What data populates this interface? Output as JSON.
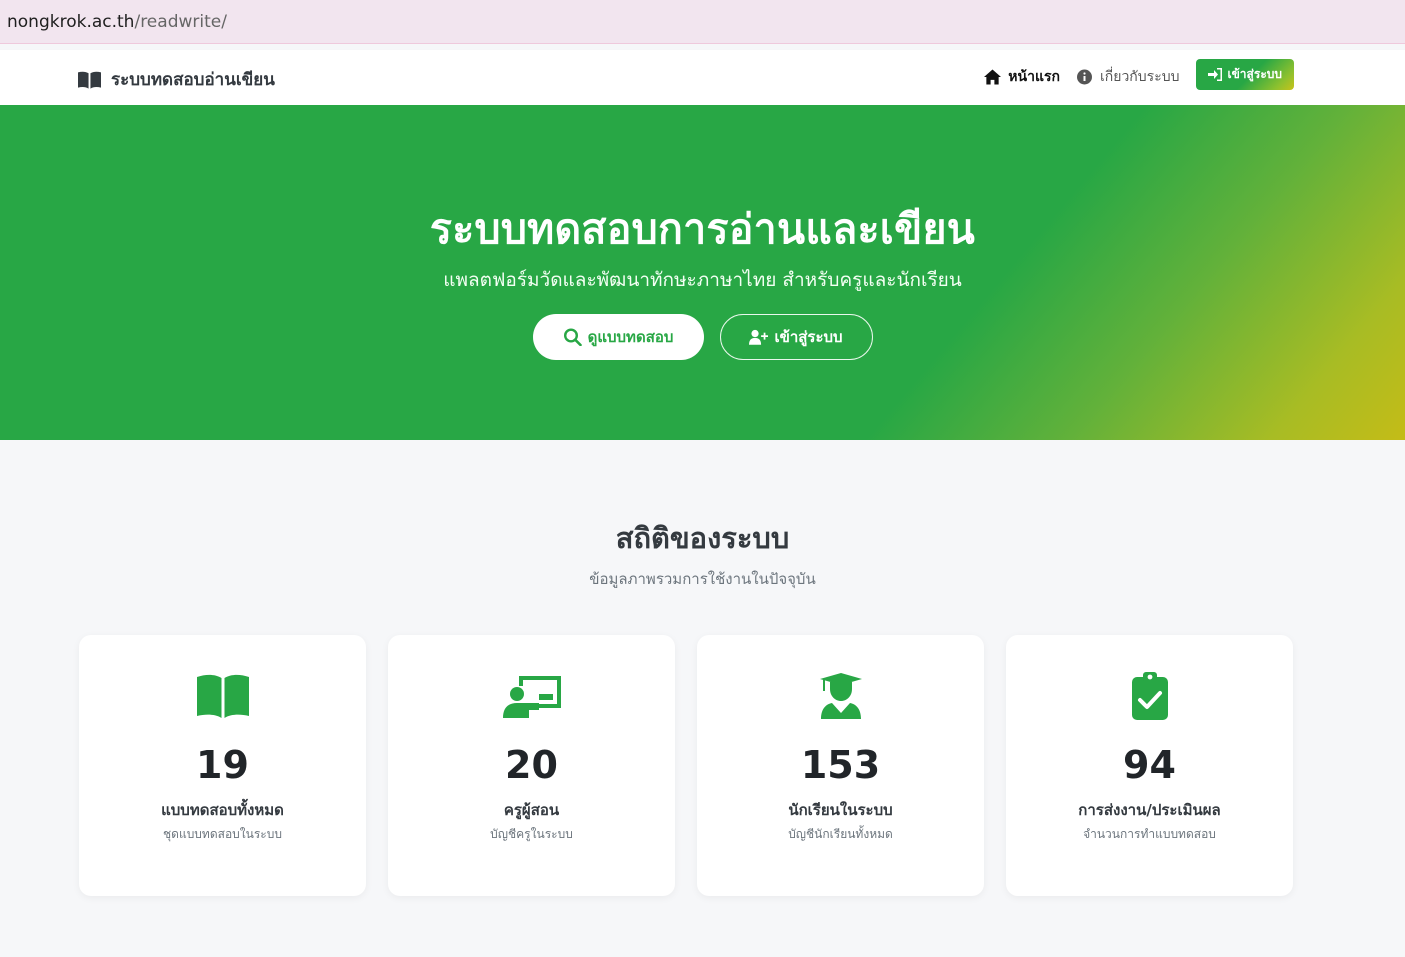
{
  "browser": {
    "url_host": "nongkrok.ac.th",
    "url_path": "/readwrite/"
  },
  "navbar": {
    "brand": "ระบบทดสอบอ่านเขียน",
    "brand_icon": "book-open-icon",
    "links": {
      "home": "หน้าแรก",
      "about": "เกี่ยวกับระบบ"
    },
    "login": "เข้าสู่ระบบ"
  },
  "hero": {
    "title": "ระบบทดสอบการอ่านและเขียน",
    "subtitle": "แพลตฟอร์มวัดและพัฒนาทักษะภาษาไทย สำหรับครูและนักเรียน",
    "btn_view": "ดูแบบทดสอบ",
    "btn_login": "เข้าสู่ระบบ"
  },
  "stats": {
    "title": "สถิติของระบบ",
    "subtitle": "ข้อมูลภาพรวมการใช้งานในปัจจุบัน",
    "cards": [
      {
        "icon": "book-open-icon",
        "value": "19",
        "label": "แบบทดสอบทั้งหมด",
        "desc": "ชุดแบบทดสอบในระบบ"
      },
      {
        "icon": "teacher-icon",
        "value": "20",
        "label": "ครูผู้สอน",
        "desc": "บัญชีครูในระบบ"
      },
      {
        "icon": "graduate-icon",
        "value": "153",
        "label": "นักเรียนในระบบ",
        "desc": "บัญชีนักเรียนทั้งหมด"
      },
      {
        "icon": "clipboard-check-icon",
        "value": "94",
        "label": "การส่งงาน/ประเมินผล",
        "desc": "จำนวนการทำแบบทดสอบ"
      }
    ]
  },
  "colors": {
    "primary": "#28a745",
    "accent": "#c4bc17"
  }
}
